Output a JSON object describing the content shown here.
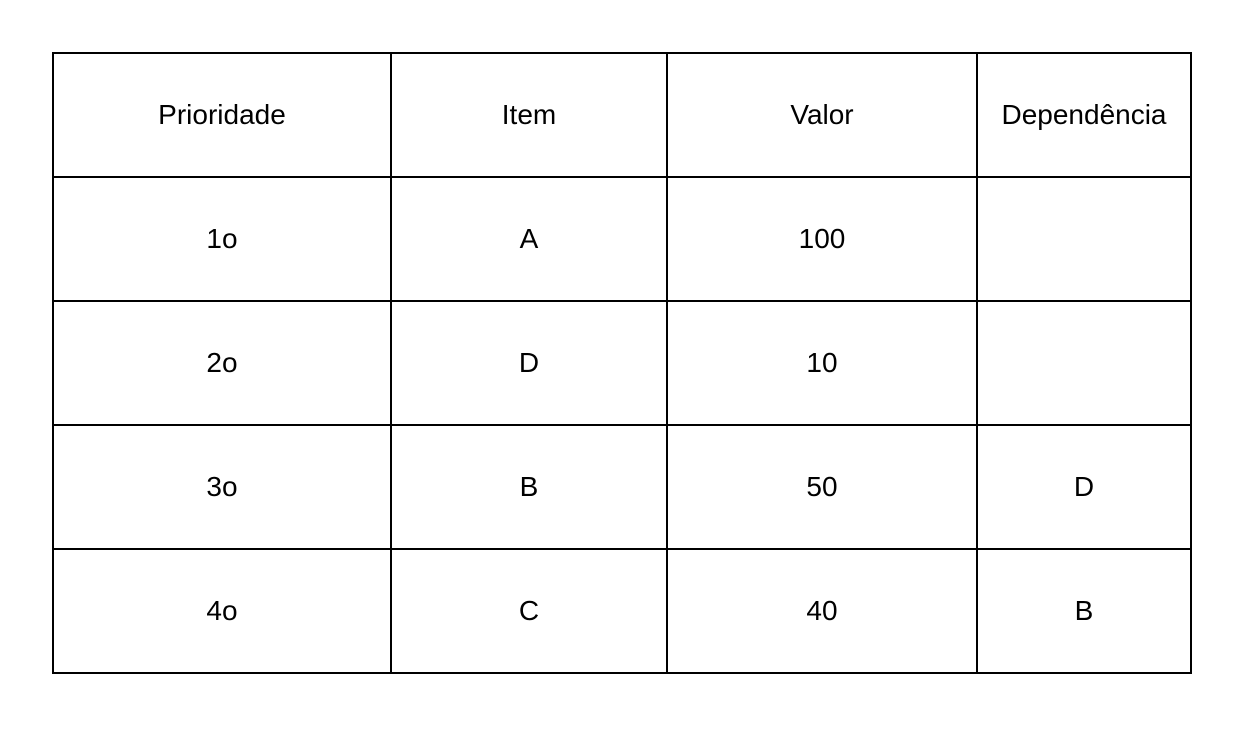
{
  "table": {
    "headers": [
      "Prioridade",
      "Item",
      "Valor",
      "Dependência"
    ],
    "rows": [
      [
        "1o",
        "A",
        "100",
        ""
      ],
      [
        "2o",
        "D",
        "10",
        ""
      ],
      [
        "3o",
        "B",
        "50",
        "D"
      ],
      [
        "4o",
        "C",
        "40",
        "B"
      ]
    ]
  }
}
